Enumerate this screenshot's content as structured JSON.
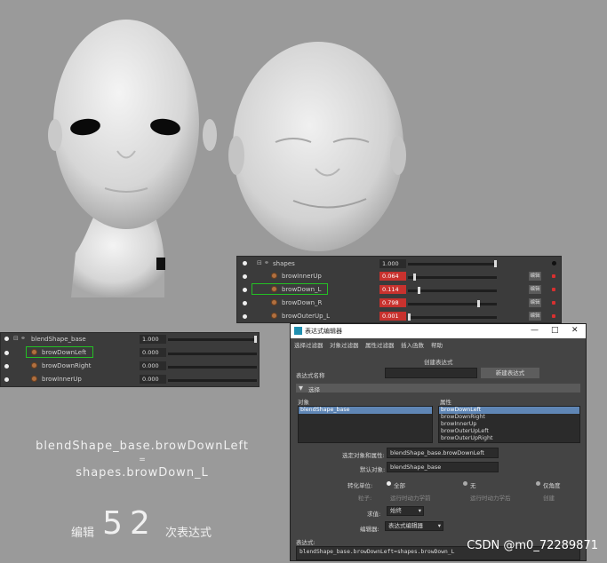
{
  "right_panel": {
    "header": {
      "label": "shapes",
      "value": "1.000"
    },
    "rows": [
      {
        "label": "browInnerUp",
        "value": "0.064",
        "edit": "编辑",
        "frac": 0.064
      },
      {
        "label": "browDown_L",
        "value": "0.114",
        "edit": "编辑",
        "frac": 0.114
      },
      {
        "label": "browDown_R",
        "value": "0.798",
        "edit": "编辑",
        "frac": 0.798
      },
      {
        "label": "browOuterUp_L",
        "value": "0.001",
        "edit": "编辑",
        "frac": 0.001
      }
    ]
  },
  "left_panel": {
    "header": {
      "label": "blendShape_base",
      "value": "1.000"
    },
    "rows": [
      {
        "label": "browDownLeft",
        "value": "0.000"
      },
      {
        "label": "browDownRight",
        "value": "0.000"
      },
      {
        "label": "browInnerUp",
        "value": "0.000"
      }
    ]
  },
  "editor": {
    "title": "表达式编辑器",
    "window_buttons": [
      "—",
      "□",
      "✕"
    ],
    "menu": [
      "选择过滤器",
      "对象过滤器",
      "属性过滤器",
      "插入函数",
      "帮助"
    ],
    "create_label": "创建表达式",
    "expr_name_label": "表达式名称",
    "new_expr_button": "新建表达式",
    "section_label": "选择",
    "objects_label": "对象",
    "attrs_label": "属性",
    "objects": [
      "blendShape_base"
    ],
    "attrs": [
      "browDownLeft",
      "browDownRight",
      "browInnerUp",
      "browOuterUpLeft",
      "browOuterUpRight"
    ],
    "selected_attr_label": "选定对象和属性:",
    "selected_attr_value": "blendShape_base.browDownLeft",
    "default_obj_label": "默认对象:",
    "default_obj_value": "blendShape_base",
    "units_label": "转化单位:",
    "units_options": [
      "全部",
      "无",
      "仅角度"
    ],
    "eval_label": "粒子:",
    "eval_options": [
      "运行时动力学前",
      "运行时动力学后",
      "创建"
    ],
    "evaluate_label": "求值:",
    "evaluate_value": "始终",
    "editor_label": "编辑器:",
    "editor_value": "表达式编辑器",
    "expression_label": "表达式:",
    "expression_value": "blendShape_base.browDownLeft=shapes.browDown_L"
  },
  "caption": {
    "line1": "blendShape_base.browDownLeft",
    "line2": "=",
    "line3": "shapes.browDown_L",
    "edit_prefix": "编辑",
    "count": "52",
    "edit_suffix": "次表达式"
  },
  "watermark": "CSDN @m0_72289871"
}
